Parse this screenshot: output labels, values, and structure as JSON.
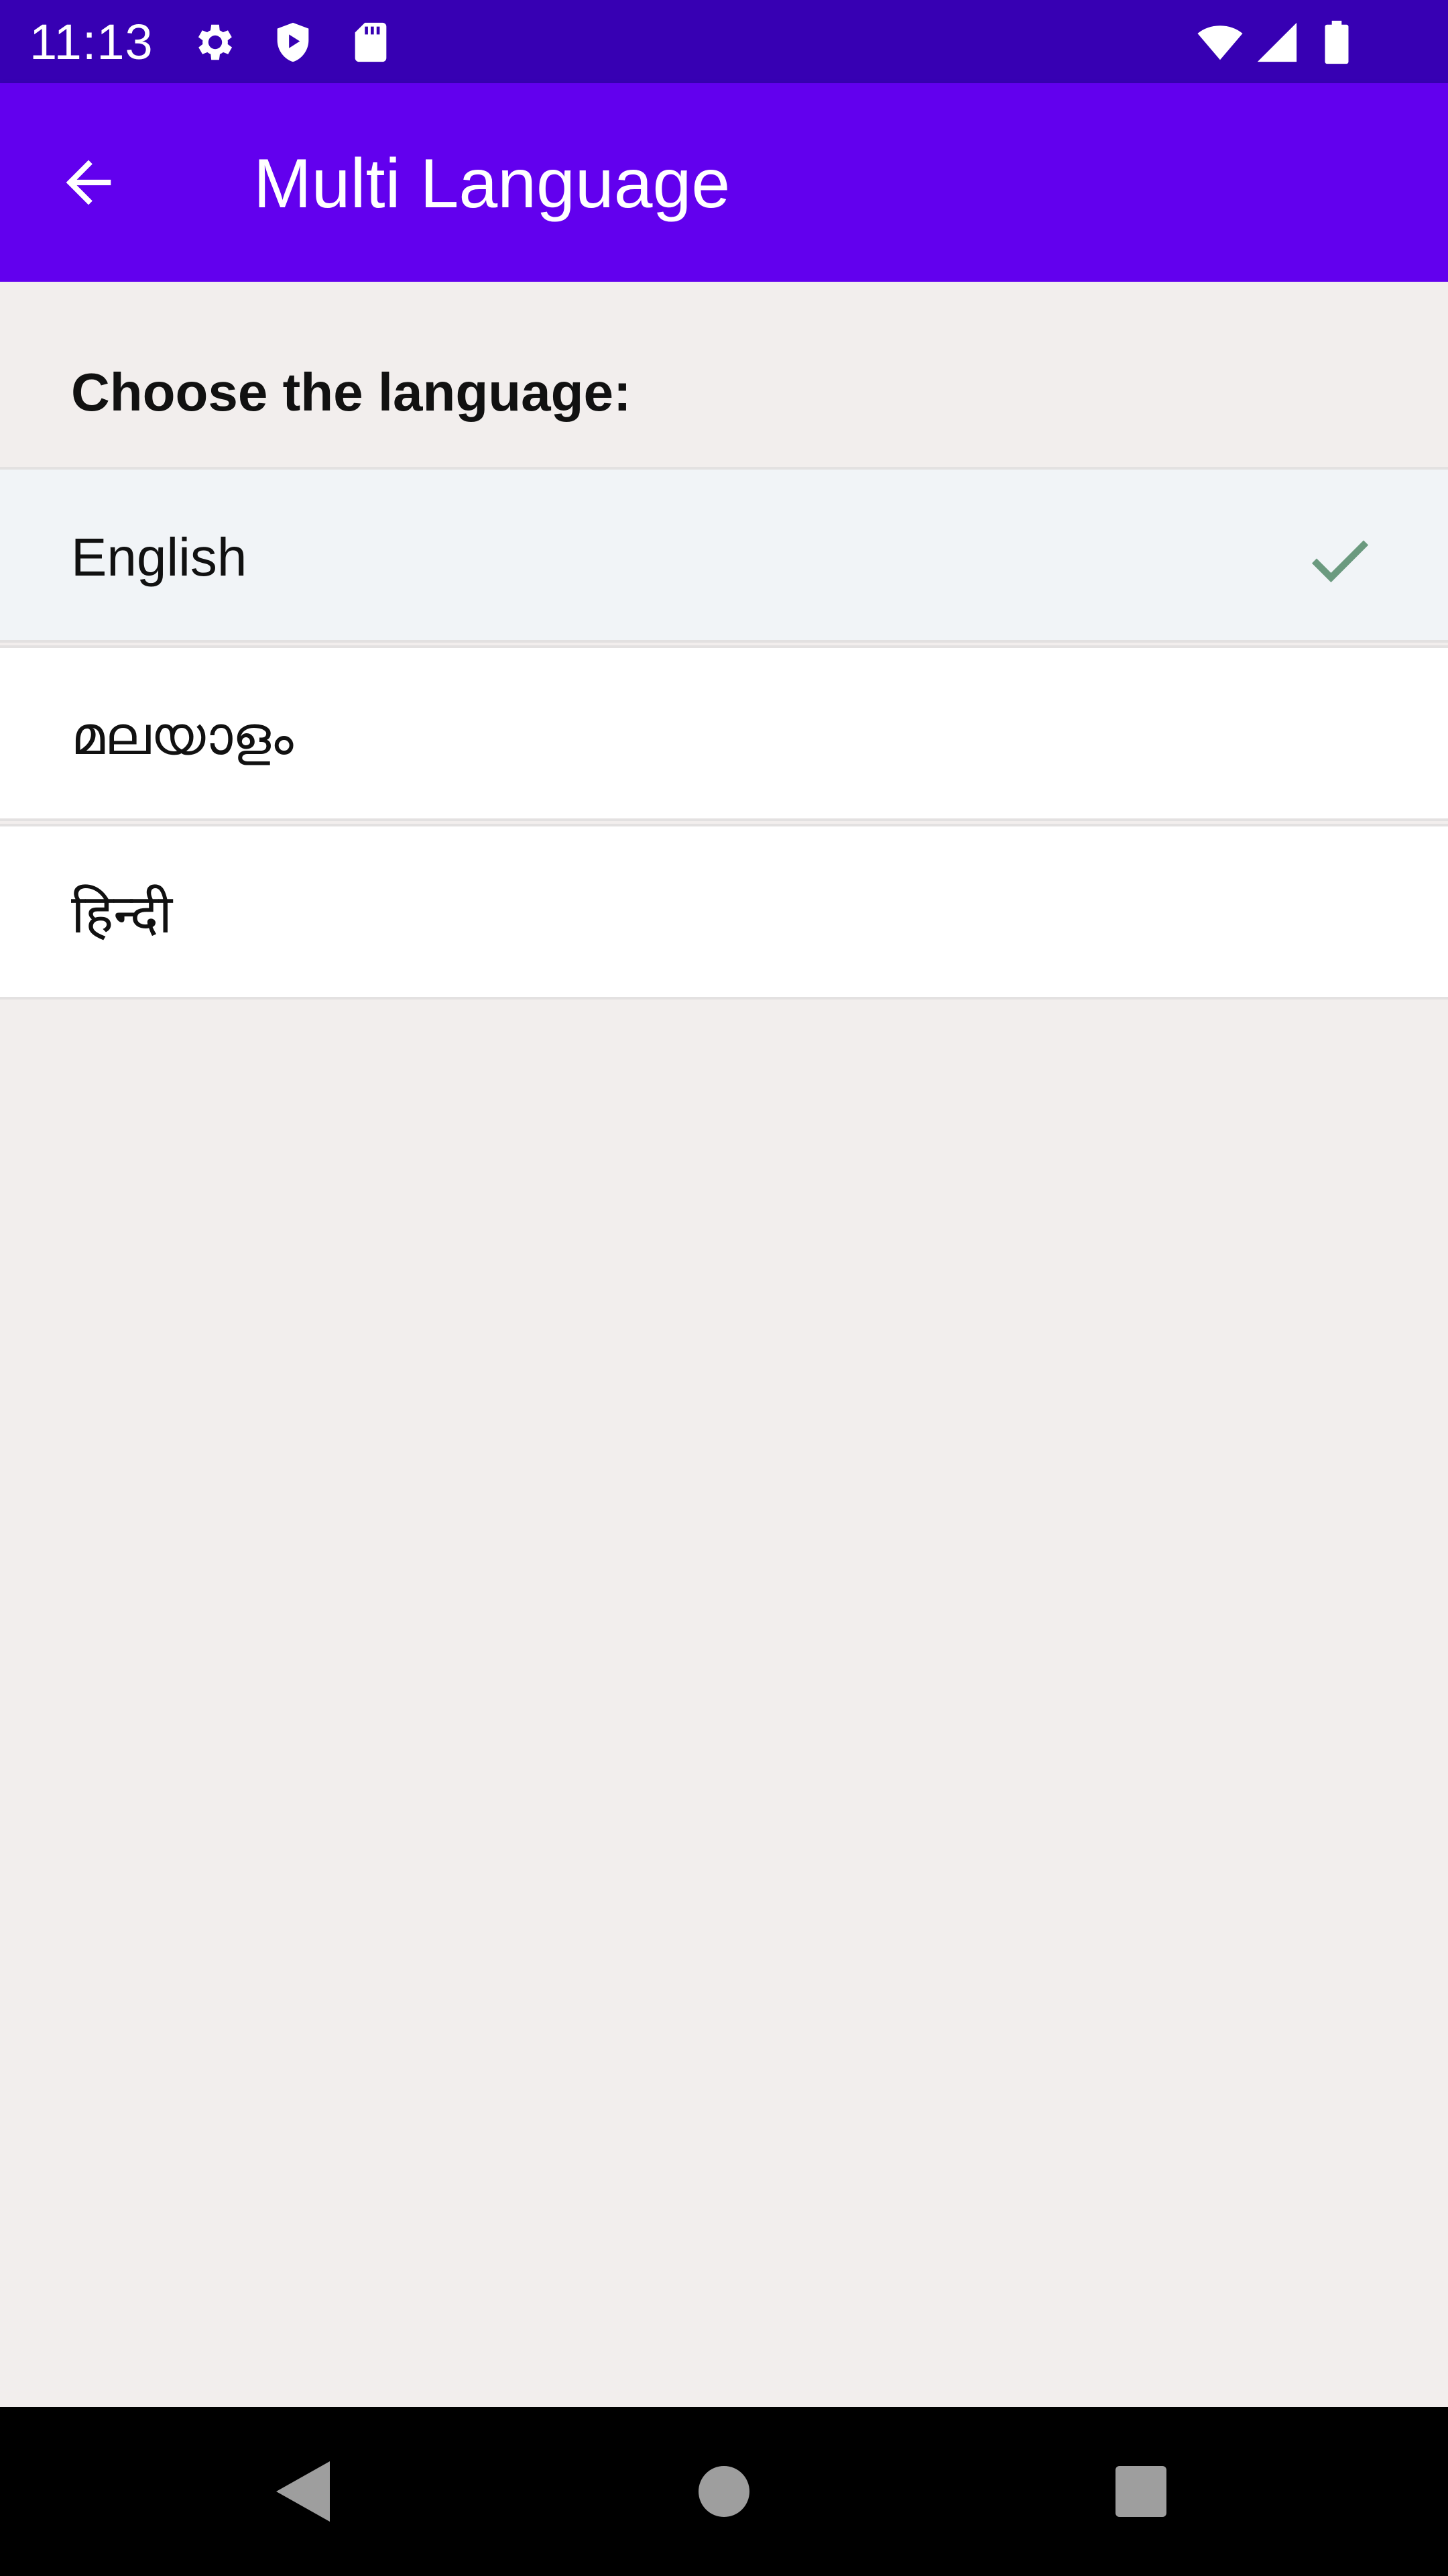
{
  "status_bar": {
    "time": "11:13",
    "left_icons": [
      "settings-icon",
      "shield-play-icon",
      "sd-card-icon"
    ],
    "right_icons": [
      "wifi-icon",
      "cell-signal-icon",
      "battery-icon"
    ]
  },
  "app_bar": {
    "title": "Multi Language",
    "back_icon": "arrow-back-icon",
    "color": "#6200ee"
  },
  "content": {
    "header": "Choose the language:",
    "languages": [
      {
        "label": "English",
        "selected": true
      },
      {
        "label": "മലയാളം",
        "selected": false
      },
      {
        "label": "हिन्दी",
        "selected": false
      }
    ],
    "check_color": "#6b9a7f"
  },
  "nav_bar": {
    "buttons": [
      "back-triangle-icon",
      "home-circle-icon",
      "recents-square-icon"
    ]
  }
}
